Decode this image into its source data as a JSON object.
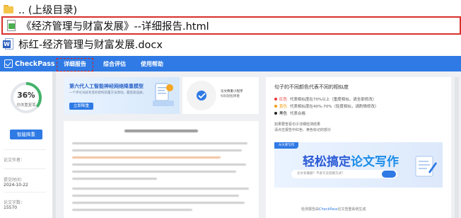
{
  "files": [
    {
      "name": ".. (上级目录)",
      "icon": "folder-icon"
    },
    {
      "name": "《经济管理与财富发展》--详细报告.html",
      "icon": "html-file-icon"
    },
    {
      "name": "标红-经济管理与财富发展.docx",
      "icon": "word-file-icon"
    }
  ],
  "report": {
    "brand": "CheckPass",
    "nav": [
      "详细报告",
      "综合评估",
      "使用帮助"
    ],
    "score": {
      "percent": "36%",
      "percent_value": 0.36,
      "label": "总体重复率"
    },
    "smart_reduce_button": "智能降重",
    "meta": {
      "author_label": "论文作者：",
      "time_label": "提交时间：",
      "time_value": "2024-10-22",
      "words_label": "论文字数：",
      "words_value": "15570"
    },
    "ad": {
      "title": "第六代人工智能神经网络降重模型",
      "text": "一个评论词总有变形结构前置方法改动，最后高品质。",
      "button": "立即降重"
    },
    "qr": {
      "title": "论文降重小程序",
      "subtitle": "扫码轻松降重"
    },
    "legend": {
      "title": "句子的不同颜色代表不同的相似度",
      "items": [
        {
          "color": "#e53935",
          "name": "红色",
          "desc": "代表相似度在70%以上（重度相似，请全部修改）"
        },
        {
          "color": "#f39c12",
          "name": "黄色",
          "desc": "代表相似度在40%-70%（轻度相似，请酌情修改）"
        },
        {
          "color": "#222222",
          "name": "黑色",
          "desc": "代表合格"
        }
      ],
      "note1": "如果要查看句子详细检测结果",
      "note2": "请点击报告中红色、黄色标记的部分"
    },
    "banner": {
      "tag": "AI大师写作",
      "headline_a": "轻松搞定",
      "headline_b": "论文写作",
      "input_placeholder": "论文有难题？不会写没思路方式？"
    },
    "footer_prefix": "检测报告由",
    "footer_brand": "CheckPass",
    "footer_suffix": "论文查重系统生成"
  },
  "colors": {
    "accent": "#2f7ae5",
    "highlight_border": "#d9302a"
  }
}
